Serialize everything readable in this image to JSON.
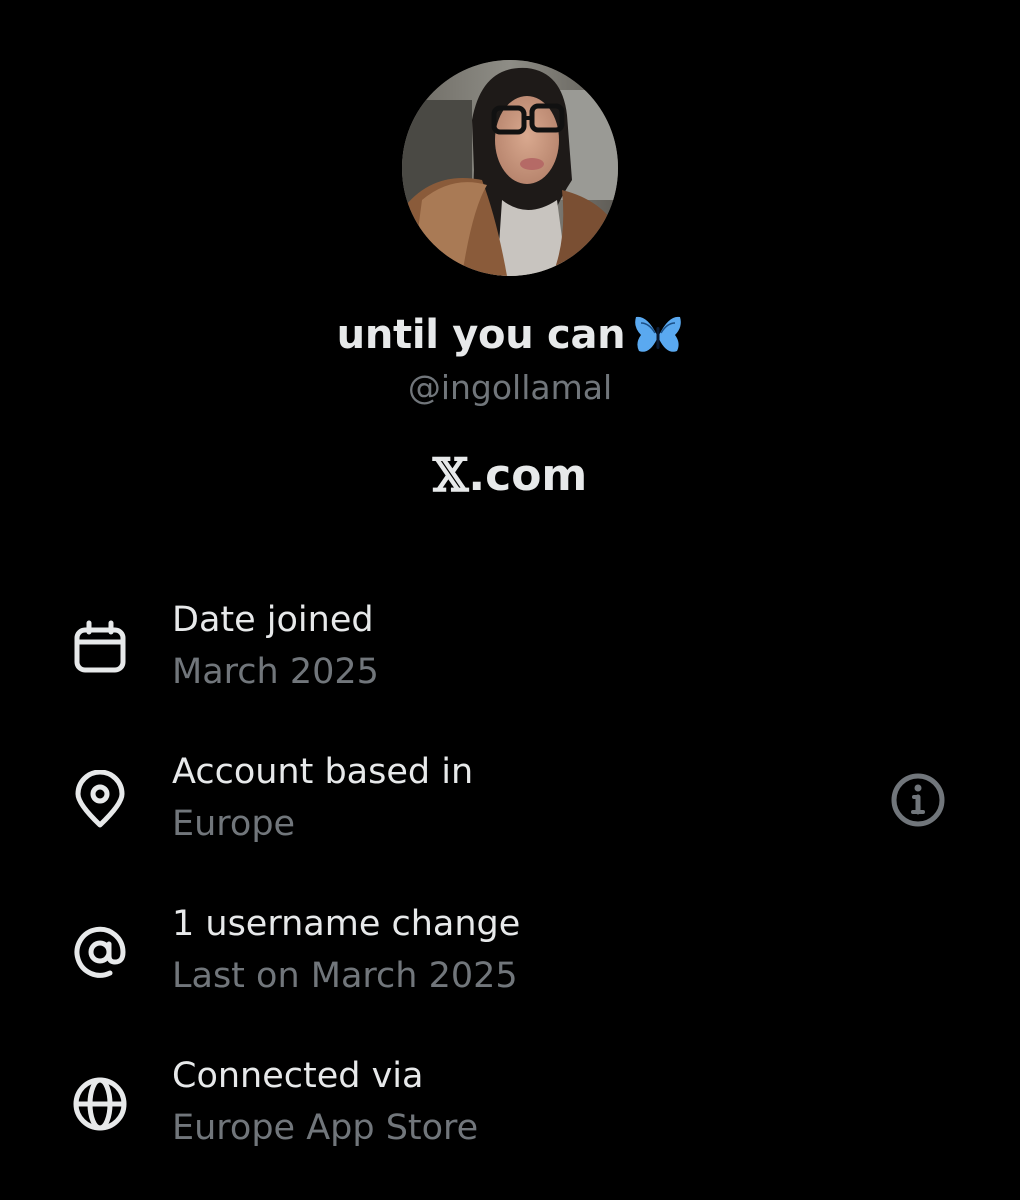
{
  "profile": {
    "display_name": "until you can",
    "name_emoji_icon": "butterfly-icon",
    "handle": "@ingollamal",
    "site_logo": "𝕏",
    "site_text": ".com"
  },
  "about": {
    "items": [
      {
        "icon": "calendar-icon",
        "title": "Date joined",
        "subtitle": "March 2025"
      },
      {
        "icon": "location-pin-icon",
        "title": "Account based in",
        "subtitle": "Europe",
        "action_icon": "info-icon"
      },
      {
        "icon": "at-sign-icon",
        "title": "1 username change",
        "subtitle": "Last on March 2025"
      },
      {
        "icon": "globe-icon",
        "title": "Connected via",
        "subtitle": "Europe App Store"
      }
    ]
  },
  "colors": {
    "background": "#000000",
    "primary_text": "#e7e9ea",
    "secondary_text": "#71767b",
    "butterfly": "#5aa9f0"
  }
}
